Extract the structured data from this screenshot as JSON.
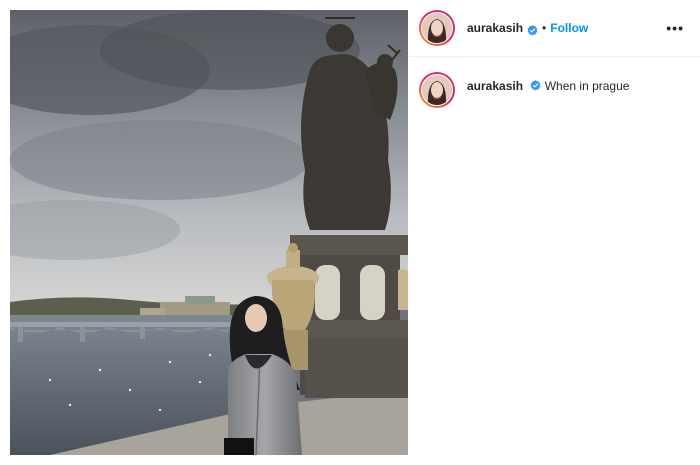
{
  "post": {
    "username": "aurakasih",
    "follow_label": "Follow",
    "separator": "•",
    "more_label": "•••",
    "caption_text": "When in prague",
    "verified_color": "#3897f0",
    "follow_color": "#0095f6"
  },
  "icons": {
    "verified": "verified-badge-icon",
    "more": "more-options-icon"
  }
}
